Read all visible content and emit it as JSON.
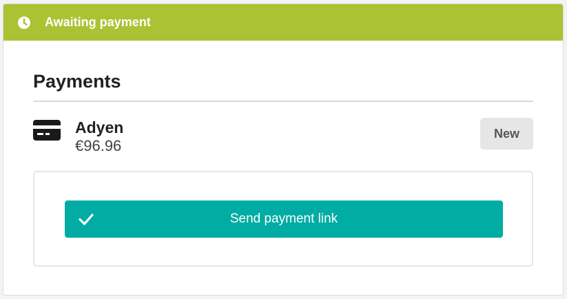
{
  "status": {
    "label": "Awaiting payment",
    "icon": "clock-icon",
    "color": "#acc235"
  },
  "payments": {
    "title": "Payments",
    "items": [
      {
        "icon": "credit-card-icon",
        "method": "Adyen",
        "amount": "€96.96",
        "state": "New"
      }
    ]
  },
  "actions": {
    "send_link_label": "Send payment link",
    "send_link_icon": "check-icon",
    "button_color": "#00aca3"
  }
}
